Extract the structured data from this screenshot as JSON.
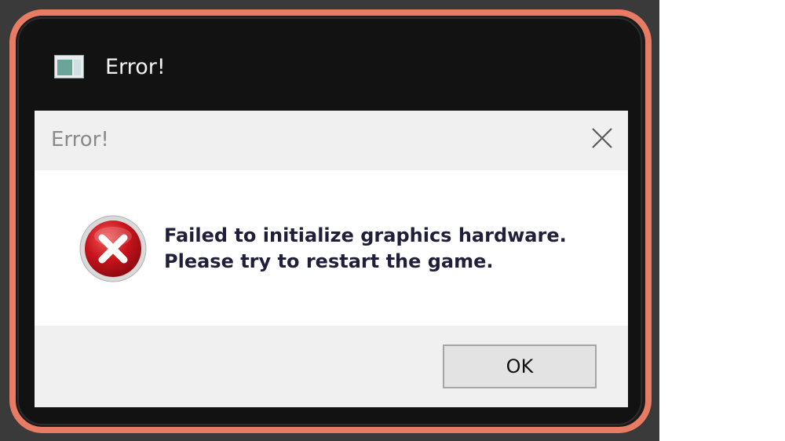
{
  "window": {
    "title": "Error!",
    "icon": "app-window-icon"
  },
  "dialog": {
    "title": "Error!",
    "close_icon": "close-icon",
    "status_icon": "error-icon",
    "message_lines": [
      "Failed to initialize graphics hardware.",
      "Please try to restart the game."
    ],
    "ok_label": "OK"
  },
  "colors": {
    "accent_outline": "#e87b63",
    "error_red": "#c8141c",
    "window_bg": "#121212",
    "dialog_bg": "#f0f0f0"
  }
}
